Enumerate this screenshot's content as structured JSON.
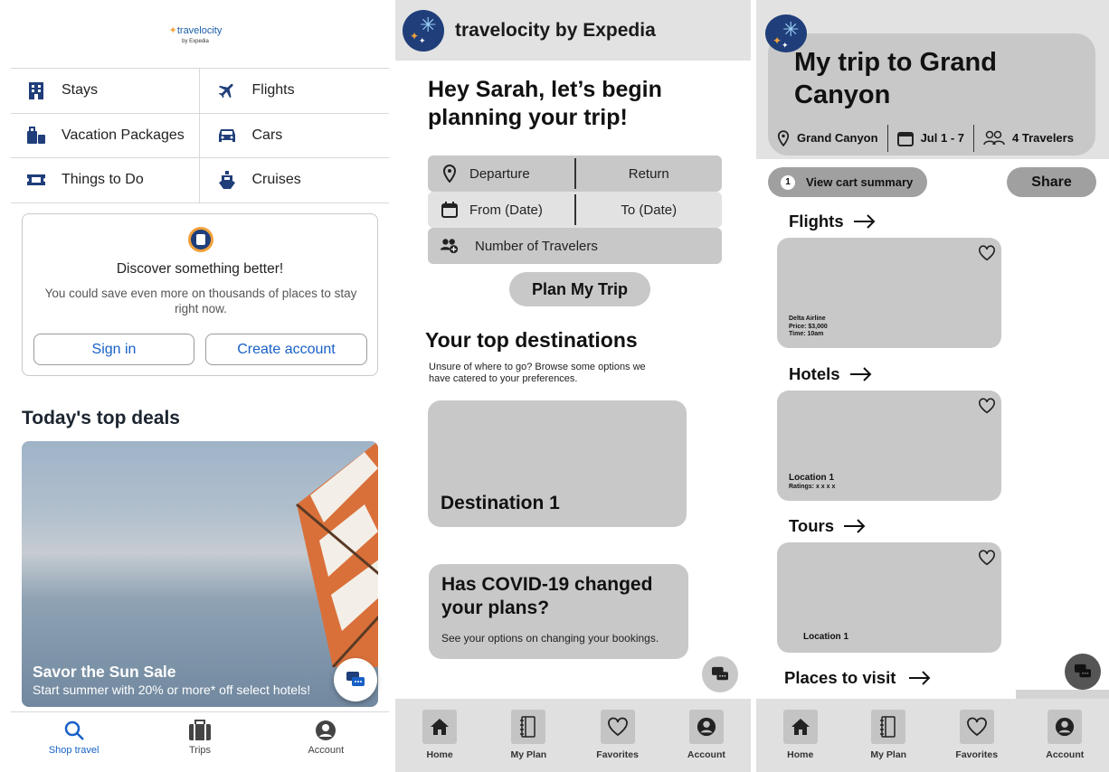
{
  "panel1": {
    "logo": {
      "brand": "travelocity",
      "sub": "by Expedia"
    },
    "categories": [
      {
        "label": "Stays",
        "icon": "building-icon"
      },
      {
        "label": "Flights",
        "icon": "airplane-icon"
      },
      {
        "label": "Vacation Packages",
        "icon": "luggage-icon"
      },
      {
        "label": "Cars",
        "icon": "car-icon"
      },
      {
        "label": "Things to Do",
        "icon": "ticket-icon"
      },
      {
        "label": "Cruises",
        "icon": "ship-icon"
      }
    ],
    "discover": {
      "title": "Discover something better!",
      "description": "You could save even more on thousands of places to stay right now.",
      "sign_in": "Sign in",
      "create_account": "Create account"
    },
    "deals": {
      "heading": "Today's top deals",
      "card_title": "Savor the Sun Sale",
      "card_subtitle": "Start summer with 20% or more* off select hotels!"
    },
    "tabs": [
      {
        "label": "Shop travel",
        "icon": "search-icon"
      },
      {
        "label": "Trips",
        "icon": "briefcase-icon"
      },
      {
        "label": "Account",
        "icon": "account-icon"
      }
    ],
    "colors": {
      "link": "#1860c6",
      "navy": "#1f3e7a",
      "accent": "#f2a13c"
    }
  },
  "panel2": {
    "header_title": "travelocity by Expedia",
    "greeting": "Hey Sarah, let’s begin planning your trip!",
    "form": {
      "departure": "Departure",
      "return": "Return",
      "from_date": "From (Date)",
      "to_date": "To (Date)",
      "travelers": "Number of Travelers"
    },
    "plan_button": "Plan My Trip",
    "top_destinations": {
      "heading": "Your top destinations",
      "subtitle": "Unsure of where to go? Browse some options we have catered to your preferences.",
      "card": "Destination 1"
    },
    "covid": {
      "title": "Has COVID-19 changed your plans?",
      "description": "See your options on changing your bookings."
    },
    "nav": [
      "Home",
      "My Plan",
      "Favorites",
      "Account"
    ]
  },
  "panel3": {
    "title": "My trip to Grand Canyon",
    "location": "Grand Canyon",
    "dates": "Jul 1 - 7",
    "travelers": "4 Travelers",
    "cart_count": "1",
    "cart_label": "View cart summary",
    "share": "Share",
    "sections": {
      "flights": "Flights",
      "hotels": "Hotels",
      "tours": "Tours",
      "places": "Places to visit"
    },
    "flight_info": [
      "Delta Airline",
      "Price: $3,000",
      "Time: 10am"
    ],
    "hotel_info": [
      "Location 1",
      "Ratings: x x x x"
    ],
    "tour_info": "Location 1",
    "nav": [
      "Home",
      "My Plan",
      "Favorites",
      "Account"
    ]
  }
}
